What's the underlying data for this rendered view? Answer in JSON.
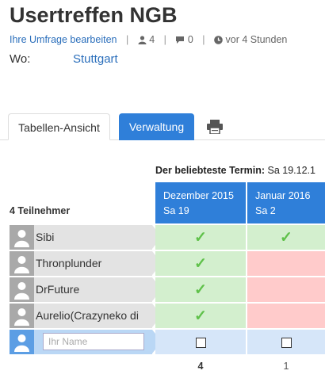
{
  "poll": {
    "title": "Usertreffen NGB"
  },
  "meta": {
    "edit_link": "Ihre Umfrage bearbeiten",
    "participants": "4",
    "comments": "0",
    "time": "vor 4 Stunden"
  },
  "location": {
    "label": "Wo:",
    "value": "Stuttgart"
  },
  "tabs": {
    "table_view": "Tabellen-Ansicht",
    "admin": "Verwaltung"
  },
  "best_date": {
    "label": "Der beliebteste Termin:",
    "value": "Sa 19.12.1"
  },
  "participant_count_label": "4 Teilnehmer",
  "columns": [
    {
      "month": "Dezember 2015",
      "day": "Sa 19"
    },
    {
      "month": "Januar 2016",
      "day": "Sa 2"
    }
  ],
  "participants": [
    {
      "name": "Sibi",
      "votes": [
        "yes",
        "yes"
      ]
    },
    {
      "name": "Thronplunder",
      "votes": [
        "yes",
        "no"
      ]
    },
    {
      "name": "DrFuture",
      "votes": [
        "yes",
        "no"
      ]
    },
    {
      "name": "Aurelio(Crazyneko di",
      "votes": [
        "yes",
        "no"
      ]
    }
  ],
  "new_entry": {
    "placeholder": "Ihr Name"
  },
  "check_glyph": "✓",
  "totals": [
    "4",
    "1"
  ],
  "colors": {
    "accent": "#2f7fd9",
    "yes": "#d3efce",
    "no": "#ffcbcb",
    "check": "#5fc14a"
  }
}
